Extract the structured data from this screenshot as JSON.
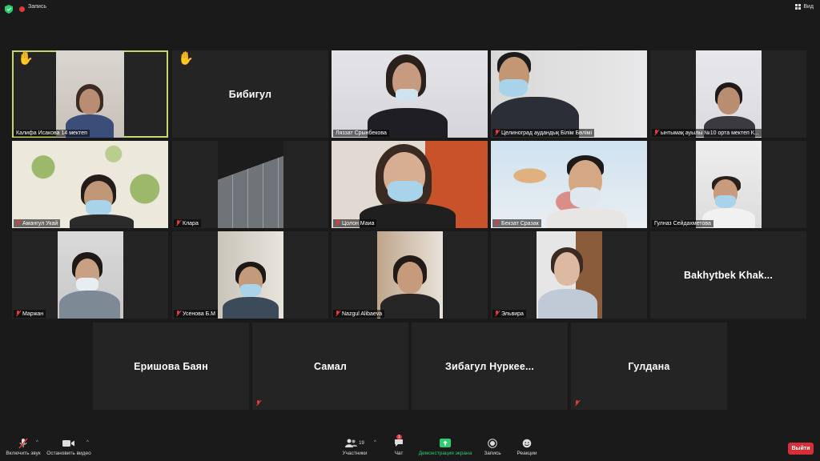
{
  "topbar": {
    "recording_label": "Запись",
    "view_label": "Вид"
  },
  "tiles": [
    {
      "name": "Калифа Исакова 14 мектеп"
    },
    {
      "name": "Бибигул"
    },
    {
      "name": "Ляззат Срынбекова"
    },
    {
      "name": "Целиноград аудандық Білім Бөлімі"
    },
    {
      "name": "ынтымақ ауылы №10 орта мектеп К..."
    },
    {
      "name": "Амангул Укай"
    },
    {
      "name": "Клара"
    },
    {
      "name": "Цолон Маиа"
    },
    {
      "name": "Бекзат Сразак"
    },
    {
      "name": "Гулназ Сейдахметова"
    },
    {
      "name": "Маржан"
    },
    {
      "name": "Усенова Б.М"
    },
    {
      "name": "Nazgul Alibaeva"
    },
    {
      "name": "Эльвира"
    },
    {
      "name": "Bakhytbek  Khak..."
    },
    {
      "name": "Еришова Баян"
    },
    {
      "name": "Самал"
    },
    {
      "name": "Зибагул  Нуркее..."
    },
    {
      "name": "Гулдана"
    }
  ],
  "toolbar": {
    "unmute_label": "Включить звук",
    "stop_video_label": "Остановить видео",
    "participants_label": "Участники",
    "participants_count": "19",
    "chat_label": "Чат",
    "chat_badge": "1",
    "share_label": "Демонстрация экрана",
    "record_label": "Запись",
    "reactions_label": "Реакции",
    "leave_label": "Выйти"
  },
  "colors": {
    "accent_green": "#2ecc71",
    "active_speaker_border": "#c6d86b",
    "leave_red": "#d5303a",
    "muted_red": "#e03a3a"
  }
}
